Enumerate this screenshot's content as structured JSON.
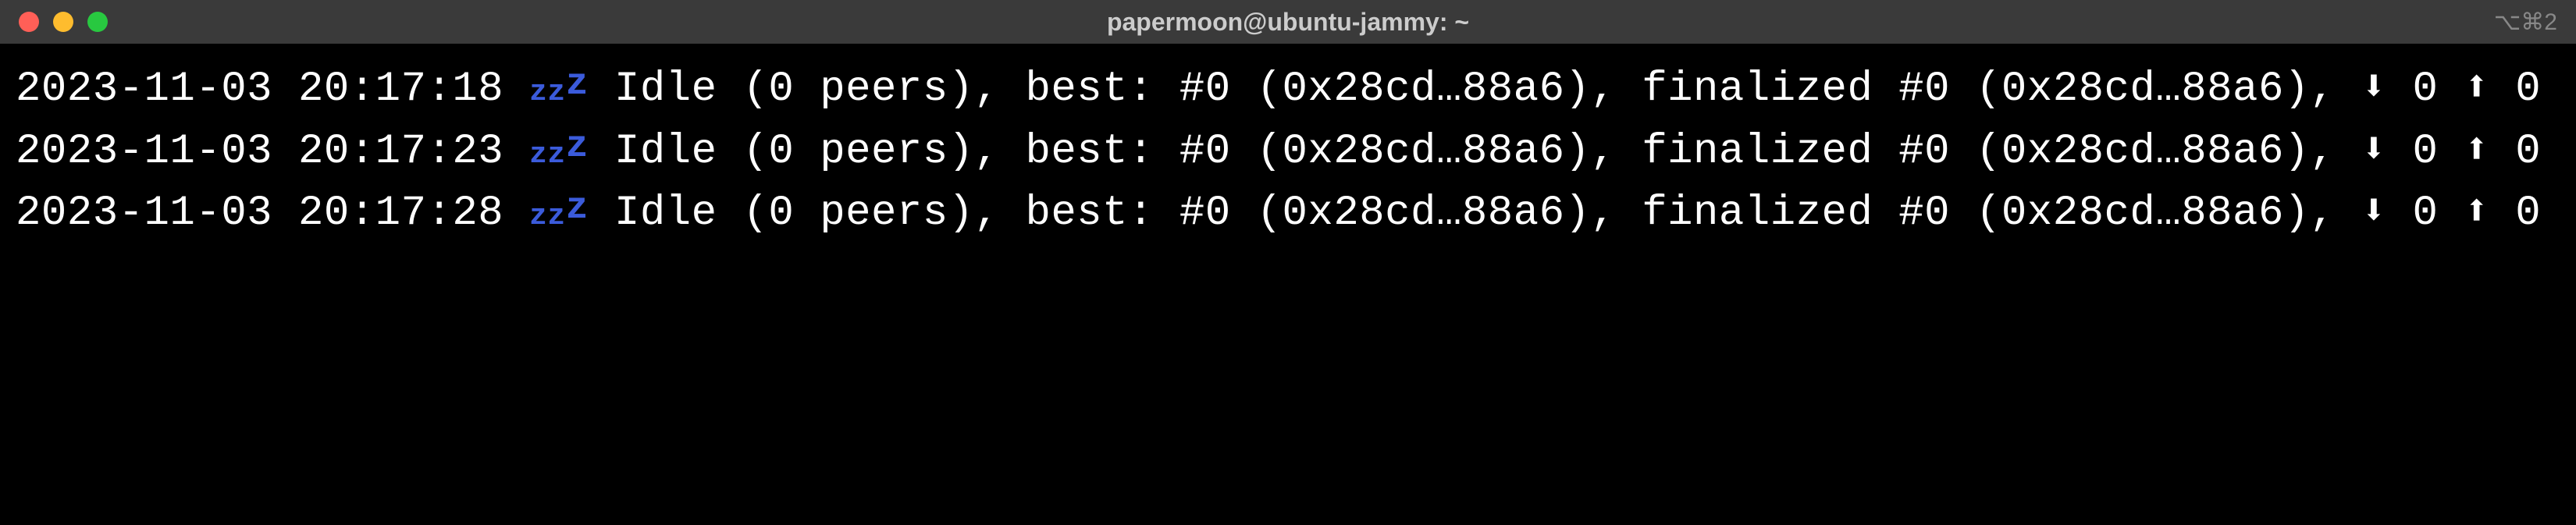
{
  "window": {
    "title": "papermoon@ubuntu-jammy: ~",
    "shortcut": "⌥⌘2"
  },
  "traffic_lights": {
    "red": "#ff5f57",
    "yellow": "#febc2e",
    "green": "#28c840"
  },
  "logs": [
    {
      "timestamp": "2023-11-03 20:17:18",
      "status": "Idle",
      "peers": 0,
      "best_block": "#0",
      "best_hash": "0x28cd…88a6",
      "finalized_block": "#0",
      "finalized_hash": "0x28cd…88a6",
      "download": 0,
      "upload": 0
    },
    {
      "timestamp": "2023-11-03 20:17:23",
      "status": "Idle",
      "peers": 0,
      "best_block": "#0",
      "best_hash": "0x28cd…88a6",
      "finalized_block": "#0",
      "finalized_hash": "0x28cd…88a6",
      "download": 0,
      "upload": 0
    },
    {
      "timestamp": "2023-11-03 20:17:28",
      "status": "Idle",
      "peers": 0,
      "best_block": "#0",
      "best_hash": "0x28cd…88a6",
      "finalized_block": "#0",
      "finalized_hash": "0x28cd…88a6",
      "download": 0,
      "upload": 0
    }
  ]
}
